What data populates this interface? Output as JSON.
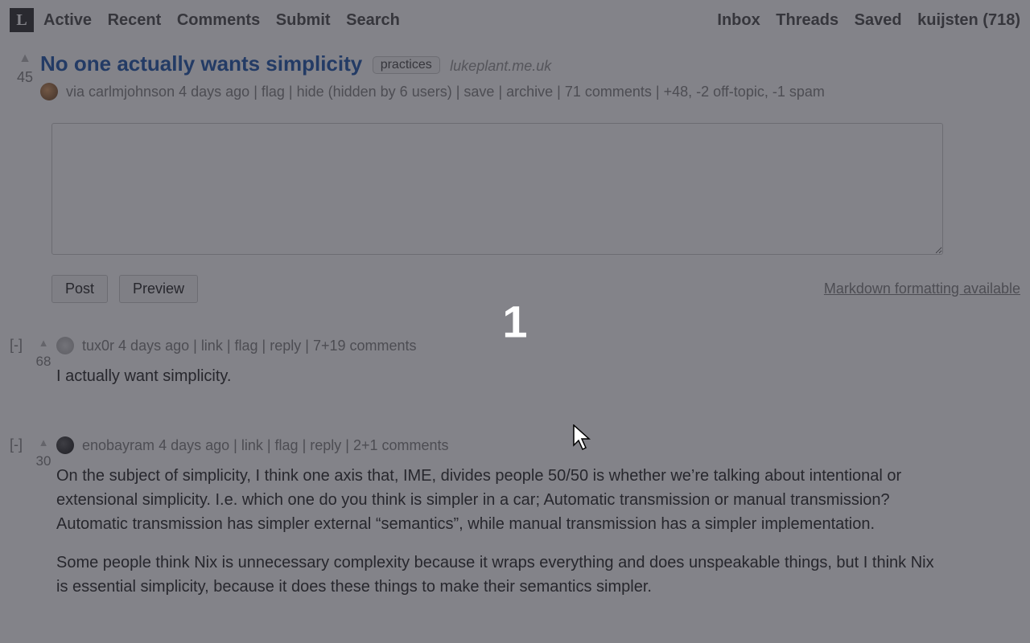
{
  "nav": {
    "logo": "L",
    "left": [
      "Active",
      "Recent",
      "Comments",
      "Submit",
      "Search"
    ],
    "right": [
      "Inbox",
      "Threads",
      "Saved",
      "kuijsten (718)"
    ]
  },
  "story": {
    "score": "45",
    "title": "No one actually wants simplicity",
    "tag": "practices",
    "domain": "lukeplant.me.uk",
    "via": "via",
    "author": "carlmjohnson",
    "age": "4 days ago",
    "flag": "flag",
    "hide": "hide (hidden by 6 users)",
    "save": "save",
    "archive": "archive",
    "comments": "71 comments",
    "votes": "+48, -2 off-topic, -1 spam"
  },
  "box": {
    "post": "Post",
    "preview": "Preview",
    "markdown": "Markdown formatting available"
  },
  "comments": [
    {
      "collapse": "[-]",
      "score": "68",
      "author": "tux0r",
      "age": "4 days ago",
      "link": "link",
      "flag": "flag",
      "reply": "reply",
      "count": "7+19 comments",
      "body_p1": "I actually want simplicity."
    },
    {
      "collapse": "[-]",
      "score": "30",
      "author": "enobayram",
      "age": "4 days ago",
      "link": "link",
      "flag": "flag",
      "reply": "reply",
      "count": "2+1 comments",
      "body_p1": "On the subject of simplicity, I think one axis that, IME, divides people 50/50 is whether we’re talking about intentional or extensional simplicity. I.e. which one do you think is simpler in a car; Automatic transmission or manual transmission? Automatic transmission has simpler external “semantics”, while manual transmission has a simpler implementation.",
      "body_p2": "Some people think Nix is unnecessary complexity because it wraps everything and does unspeakable things, but I think Nix is essential simplicity, because it does these things to make their semantics simpler."
    }
  ],
  "overlay": {
    "badge": "1"
  }
}
